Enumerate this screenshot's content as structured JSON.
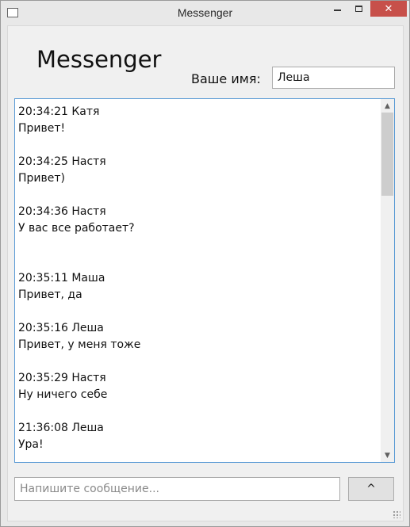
{
  "window": {
    "title": "Messenger",
    "close_glyph": "✕",
    "accent_color": "#c7504a"
  },
  "header": {
    "title": "Messenger",
    "name_label": "Ваше имя:",
    "name_value": "Леша"
  },
  "messages": [
    {
      "time": "20:34:21",
      "author": "Катя",
      "text": "Привет!"
    },
    {
      "time": "20:34:25",
      "author": "Настя",
      "text": "Привет)"
    },
    {
      "time": "20:34:36",
      "author": "Настя",
      "text": "У вас все работает?"
    },
    {
      "time": "20:35:11",
      "author": "Маша",
      "text": "Привет, да"
    },
    {
      "time": "20:35:16",
      "author": "Леша",
      "text": "Привет, у меня тоже"
    },
    {
      "time": "20:35:29",
      "author": "Настя",
      "text": "Ну ничего себе"
    },
    {
      "time": "21:36:08",
      "author": "Леша",
      "text": "Ура!"
    }
  ],
  "composer": {
    "placeholder": "Напишите сообщение...",
    "value": "",
    "send_label": "^"
  },
  "icons": {
    "scroll_up": "▲",
    "scroll_down": "▼"
  }
}
